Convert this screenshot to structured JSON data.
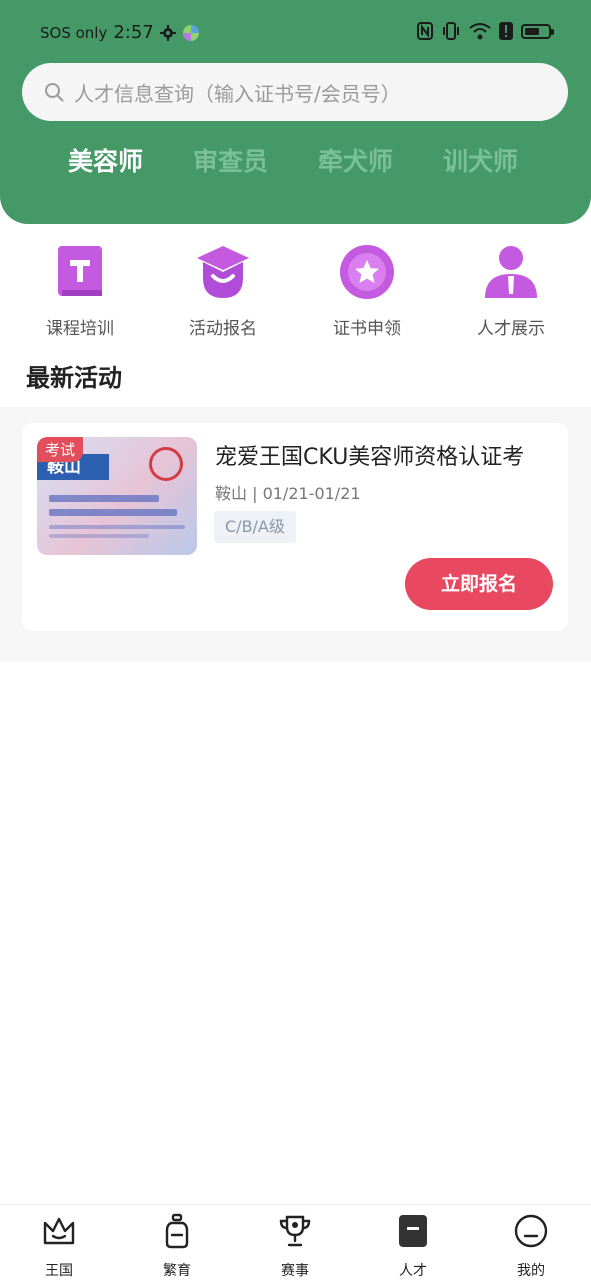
{
  "status_bar": {
    "carrier": "SOS only",
    "time": "2:57"
  },
  "search": {
    "placeholder": "人才信息查询（输入证书号/会员号）"
  },
  "tabs": [
    {
      "label": "美容师",
      "active": true
    },
    {
      "label": "审查员",
      "active": false
    },
    {
      "label": "牵犬师",
      "active": false
    },
    {
      "label": "训犬师",
      "active": false
    }
  ],
  "quick_actions": [
    {
      "label": "课程培训",
      "icon": "course-icon"
    },
    {
      "label": "活动报名",
      "icon": "graduation-cap-icon"
    },
    {
      "label": "证书申领",
      "icon": "star-badge-icon"
    },
    {
      "label": "人才展示",
      "icon": "person-icon"
    }
  ],
  "section": {
    "title": "最新活动"
  },
  "activity": {
    "tag": "考试",
    "thumb_text": "鞍山",
    "title": "宠爱王国CKU美容师资格认证考",
    "meta": "鞍山 | 01/21-01/21",
    "level": "C/B/A级",
    "button": "立即报名"
  },
  "bottom_nav": [
    {
      "label": "王国",
      "icon": "crown-icon"
    },
    {
      "label": "繁育",
      "icon": "bottle-icon"
    },
    {
      "label": "赛事",
      "icon": "trophy-icon"
    },
    {
      "label": "人才",
      "icon": "talent-icon",
      "active": true
    },
    {
      "label": "我的",
      "icon": "profile-icon"
    }
  ],
  "colors": {
    "header_green": "#449966",
    "accent_red": "#e84860",
    "icon_purple": "#c35ae0"
  }
}
